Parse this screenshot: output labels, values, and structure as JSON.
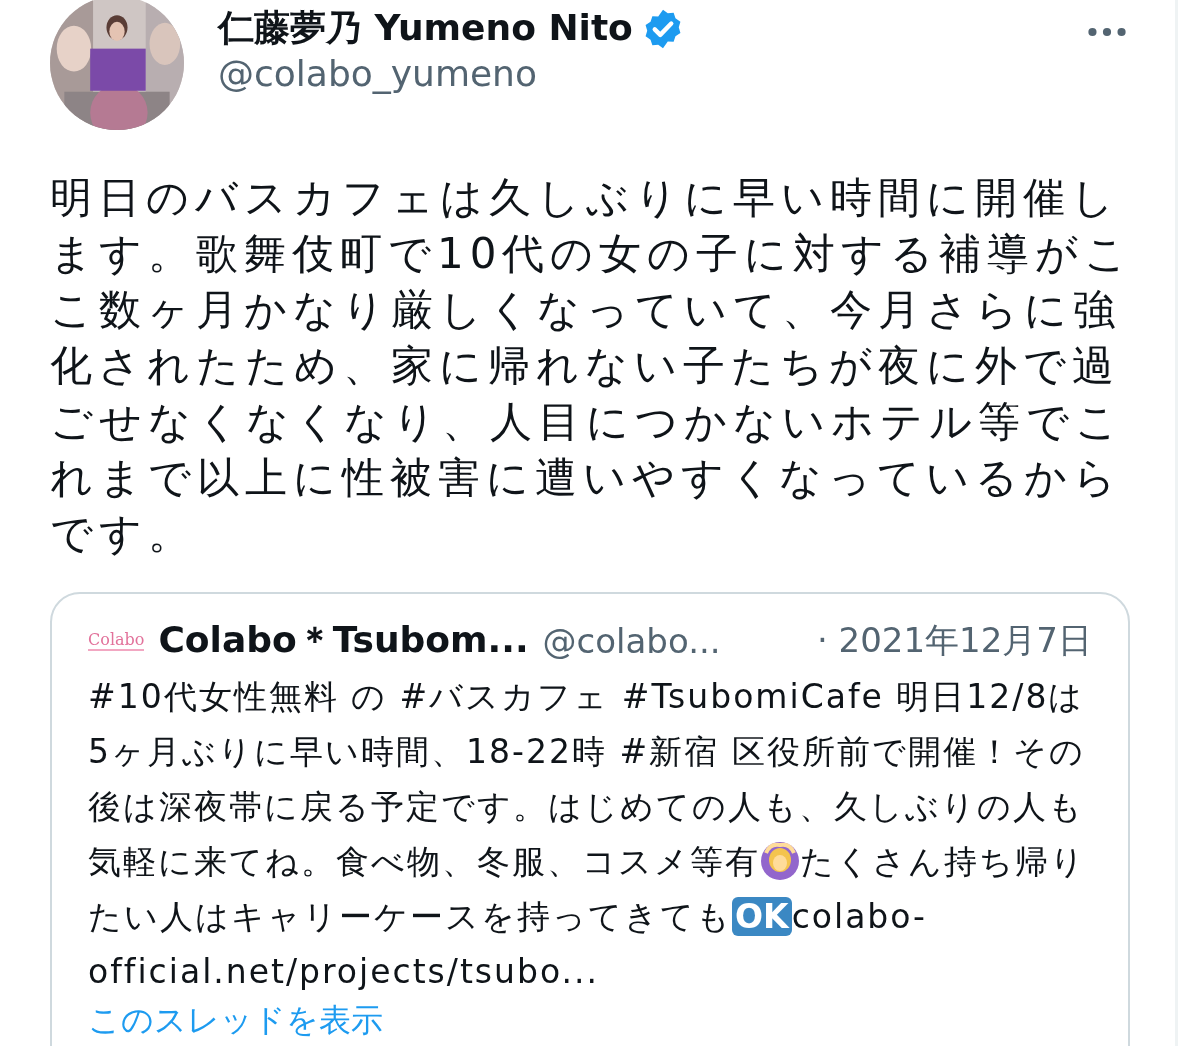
{
  "author": {
    "name": "仁藤夢乃 Yumeno Nito",
    "verified": true,
    "handle": "@colabo_yumeno"
  },
  "text": "明日のバスカフェは久しぶりに早い時間に開催します。歌舞伎町で10代の女の子に対する補導がここ数ヶ月かなり厳しくなっていて、今月さらに強化されたため、家に帰れない子たちが夜に外で過ごせなくなくなり、人目につかないホテル等でこれまで以上に性被害に遭いやすくなっているからです。",
  "quote": {
    "logo": "Colabo",
    "name": "Colabo＊Tsubom...",
    "handle": "@colabo...",
    "date": "· 2021年12月7日",
    "body": [
      {
        "kind": "text",
        "text": "#10代女性無料 の #バスカフェ #TsubomiCafe 明日12/8は5ヶ月ぶりに早い時間、18-22時 #新宿 区役所前で開催！その後は深夜帯に戻る予定です。はじめての人も、久しぶりの人も気軽に来てね。食べ物、冬服、コスメ等有"
      },
      {
        "kind": "emoji"
      },
      {
        "kind": "text",
        "text": "たくさん持ち帰りたい人はキャリーケースを持ってきても"
      },
      {
        "kind": "badge",
        "text": "OK"
      },
      {
        "kind": "text",
        "text": "colabo-official.net/projects/tsubo..."
      }
    ],
    "thread_link": "このスレッドを表示"
  }
}
